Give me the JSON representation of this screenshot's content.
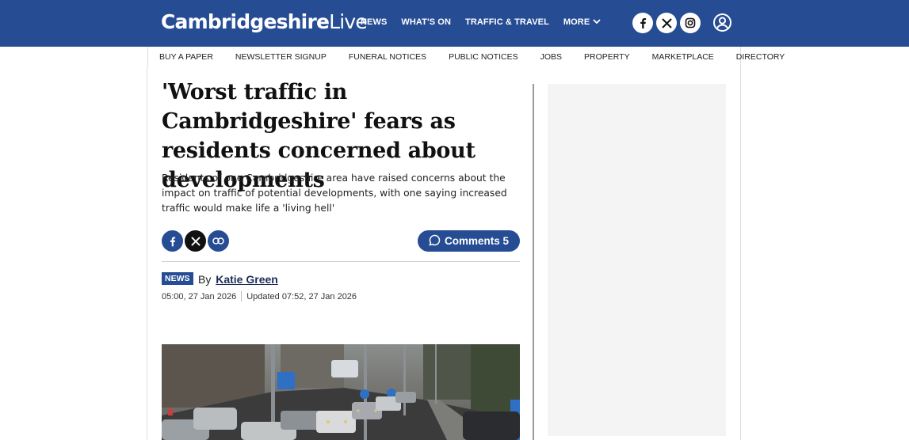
{
  "header": {
    "logo_bold": "Cambridgeshire",
    "logo_light": "Live",
    "nav": [
      "NEWS",
      "WHAT'S ON",
      "TRAFFIC & TRAVEL",
      "MORE"
    ],
    "social_icons": [
      "facebook-icon",
      "x-icon",
      "instagram-icon"
    ],
    "account_icon": "user-icon",
    "brand_color": "#264c94"
  },
  "subnav": [
    "BUY A PAPER",
    "NEWSLETTER SIGNUP",
    "FUNERAL NOTICES",
    "PUBLIC NOTICES",
    "JOBS",
    "PROPERTY",
    "MARKETPLACE",
    "DIRECTORY"
  ],
  "article": {
    "headline": "'Worst traffic in Cambridgeshire' fears as residents concerned about developments",
    "standfirst": "Residents of one Cambridgeshire area have raised concerns about the impact on traffic of potential developments, with one saying increased traffic would make life a 'living hell'",
    "share_icons": [
      "facebook-icon",
      "x-icon",
      "link-icon"
    ],
    "comments_label": "Comments 5",
    "category": "NEWS",
    "by": "By",
    "author": "Katie Green",
    "published": "05:00, 27 Jan 2026",
    "updated": "Updated 07:52, 27 Jan 2026"
  }
}
